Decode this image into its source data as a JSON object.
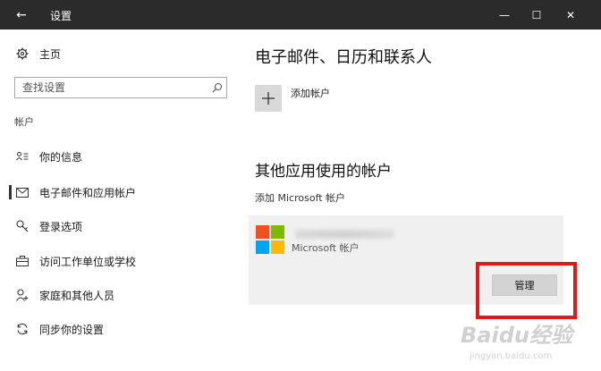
{
  "window": {
    "title": "设置",
    "back_glyph": "←",
    "minimize_glyph": "—",
    "maximize_glyph": "☐",
    "close_glyph": "✕"
  },
  "sidebar": {
    "home_label": "主页",
    "search_placeholder": "查找设置",
    "section_label": "帐户",
    "items": [
      {
        "label": "你的信息",
        "icon": "person-list-icon"
      },
      {
        "label": "电子邮件和应用帐户",
        "icon": "mail-icon",
        "active": true
      },
      {
        "label": "登录选项",
        "icon": "key-icon"
      },
      {
        "label": "访问工作单位或学校",
        "icon": "briefcase-icon"
      },
      {
        "label": "家庭和其他人员",
        "icon": "person-add-icon"
      },
      {
        "label": "同步你的设置",
        "icon": "sync-icon"
      }
    ]
  },
  "main": {
    "email_heading": "电子邮件、日历和联系人",
    "add_account_label": "添加帐户",
    "other_apps_heading": "其他应用使用的帐户",
    "add_ms_account_link": "添加 Microsoft 帐户",
    "account_card": {
      "account_type": "Microsoft 帐户",
      "manage_label": "管理"
    }
  },
  "watermark": {
    "main": "Baidu经验",
    "sub": "jingyan.baidu.com"
  },
  "colors": {
    "titlebar": "#2b2b2b",
    "card_bg": "#f0f0f0",
    "highlight": "#e01919",
    "ms_red": "#f25022",
    "ms_green": "#7fba00",
    "ms_blue": "#00a4ef",
    "ms_yellow": "#ffb900"
  }
}
